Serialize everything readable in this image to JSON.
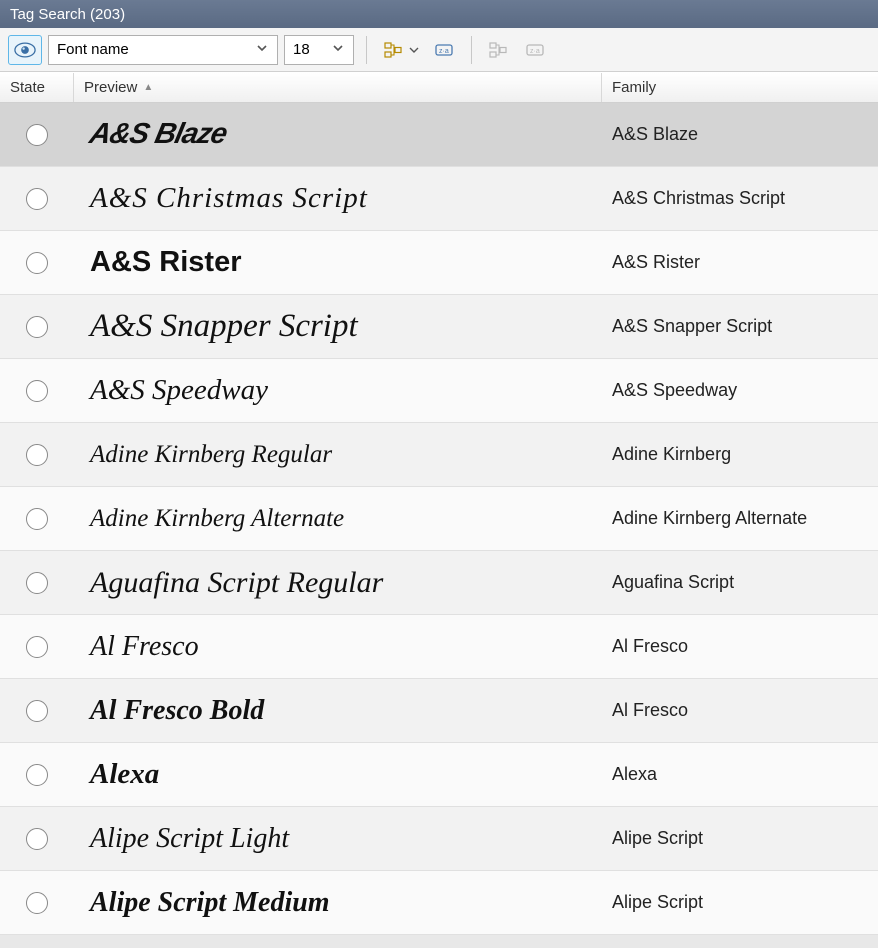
{
  "window": {
    "title": "Tag Search (203)"
  },
  "toolbar": {
    "font_input": "Font name",
    "size_input": "18"
  },
  "columns": {
    "state": "State",
    "preview": "Preview",
    "family": "Family"
  },
  "rows": [
    {
      "preview": "A&S Blaze",
      "family": "A&S Blaze",
      "fclass": "f0",
      "selected": true
    },
    {
      "preview": "A&S Christmas Script",
      "family": "A&S Christmas Script",
      "fclass": "f1",
      "selected": false
    },
    {
      "preview": "A&S Rister",
      "family": "A&S Rister",
      "fclass": "f2",
      "selected": false
    },
    {
      "preview": "A&S Snapper Script",
      "family": "A&S Snapper Script",
      "fclass": "f3",
      "selected": false
    },
    {
      "preview": "A&S Speedway",
      "family": "A&S Speedway",
      "fclass": "f4",
      "selected": false
    },
    {
      "preview": "Adine Kirnberg Regular",
      "family": "Adine Kirnberg",
      "fclass": "f5",
      "selected": false
    },
    {
      "preview": "Adine Kirnberg Alternate",
      "family": "Adine Kirnberg Alternate",
      "fclass": "f6",
      "selected": false
    },
    {
      "preview": "Aguafina Script Regular",
      "family": "Aguafina Script",
      "fclass": "f7",
      "selected": false
    },
    {
      "preview": "Al Fresco",
      "family": "Al Fresco",
      "fclass": "f8",
      "selected": false
    },
    {
      "preview": "Al Fresco Bold",
      "family": "Al Fresco",
      "fclass": "f9",
      "selected": false
    },
    {
      "preview": "Alexa",
      "family": "Alexa",
      "fclass": "f10",
      "selected": false
    },
    {
      "preview": "Alipe Script Light",
      "family": "Alipe Script",
      "fclass": "f11",
      "selected": false
    },
    {
      "preview": "Alipe Script Medium",
      "family": "Alipe Script",
      "fclass": "f12",
      "selected": false
    }
  ]
}
